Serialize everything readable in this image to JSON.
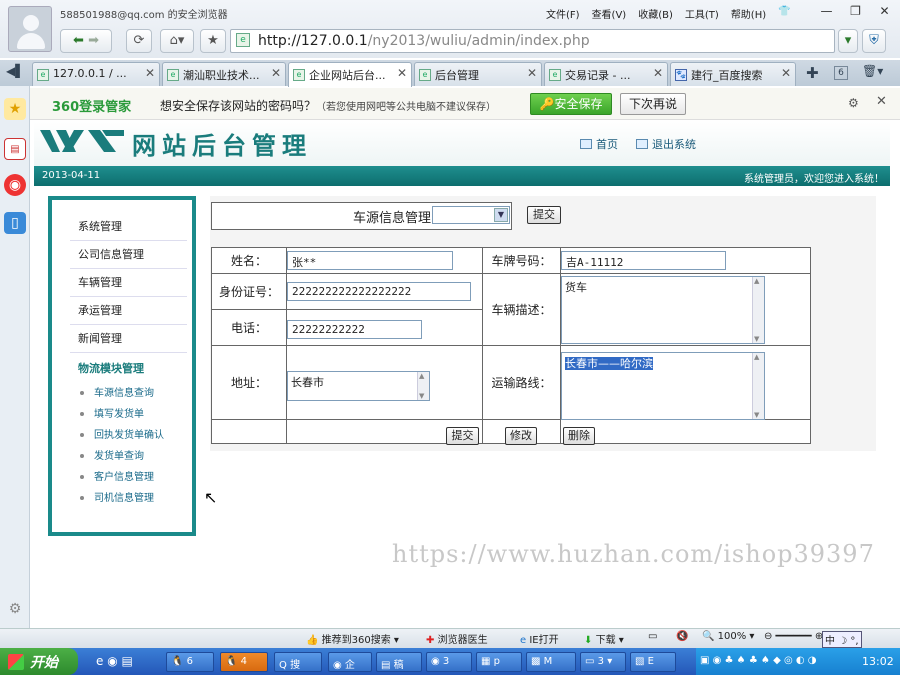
{
  "browser": {
    "user": "588501988@qq.com 的安全浏览器",
    "menus": [
      "文件(F)",
      "查看(V)",
      "收藏(B)",
      "工具(T)",
      "帮助(H)"
    ],
    "address_host": "http://127.0.0.1",
    "address_path": "/ny2013/wuliu/admin/index.php",
    "tabs": [
      "127.0.0.1 / ...",
      "潮汕职业技术...",
      "企业网站后台...",
      "后台管理",
      "交易记录 - ...",
      "建行_百度搜索"
    ],
    "tab_count": "6"
  },
  "password_bar": {
    "brand": "360登录管家",
    "message": "想安全保存该网站的密码吗？",
    "note": "（若您使用网吧等公共电脑不建议保存）",
    "save_label": "安全保存",
    "later_label": "下次再说"
  },
  "header": {
    "title": "网站后台管理",
    "nav_home": "首页",
    "nav_logout": "退出系统",
    "date": "2013-04-11",
    "welcome": "系统管理员，欢迎您进入系统！"
  },
  "menu": {
    "items": [
      "系统管理",
      "公司信息管理",
      "车辆管理",
      "承运管理",
      "新闻管理"
    ],
    "section": "物流模块管理",
    "subitems": [
      "车源信息查询",
      "填写发货单",
      "回执发货单确认",
      "发货单查询",
      "客户信息管理",
      "司机信息管理"
    ]
  },
  "form": {
    "header_label": "车源信息管理",
    "header_submit": "提交",
    "name_label": "姓名：",
    "name_value": "张**",
    "plate_label": "车牌号码：",
    "plate_value": "吉A-11112",
    "id_label": "身份证号：",
    "id_value": "222222222222222222",
    "desc_label": "车辆描述：",
    "desc_value": "货车",
    "phone_label": "电话：",
    "phone_value": "22222222222",
    "address_label": "地址：",
    "address_value": "长春市",
    "route_label": "运输路线：",
    "route_value": "长春市——哈尔滨",
    "submit_label": "提交",
    "modify_label": "修改",
    "delete_label": "删除"
  },
  "watermark": "https://www.huzhan.com/ishop39397",
  "statusbar": {
    "recommend": "推荐到360搜索",
    "doctor": "浏览器医生",
    "ie_open": "IE打开",
    "download": "下载",
    "zoom": "100%"
  },
  "taskbar": {
    "start": "开始",
    "tasks": [
      "6",
      "4",
      "搜",
      "企",
      "稿",
      "3",
      "p",
      "M",
      "3",
      "E"
    ],
    "clock": "13:02"
  }
}
